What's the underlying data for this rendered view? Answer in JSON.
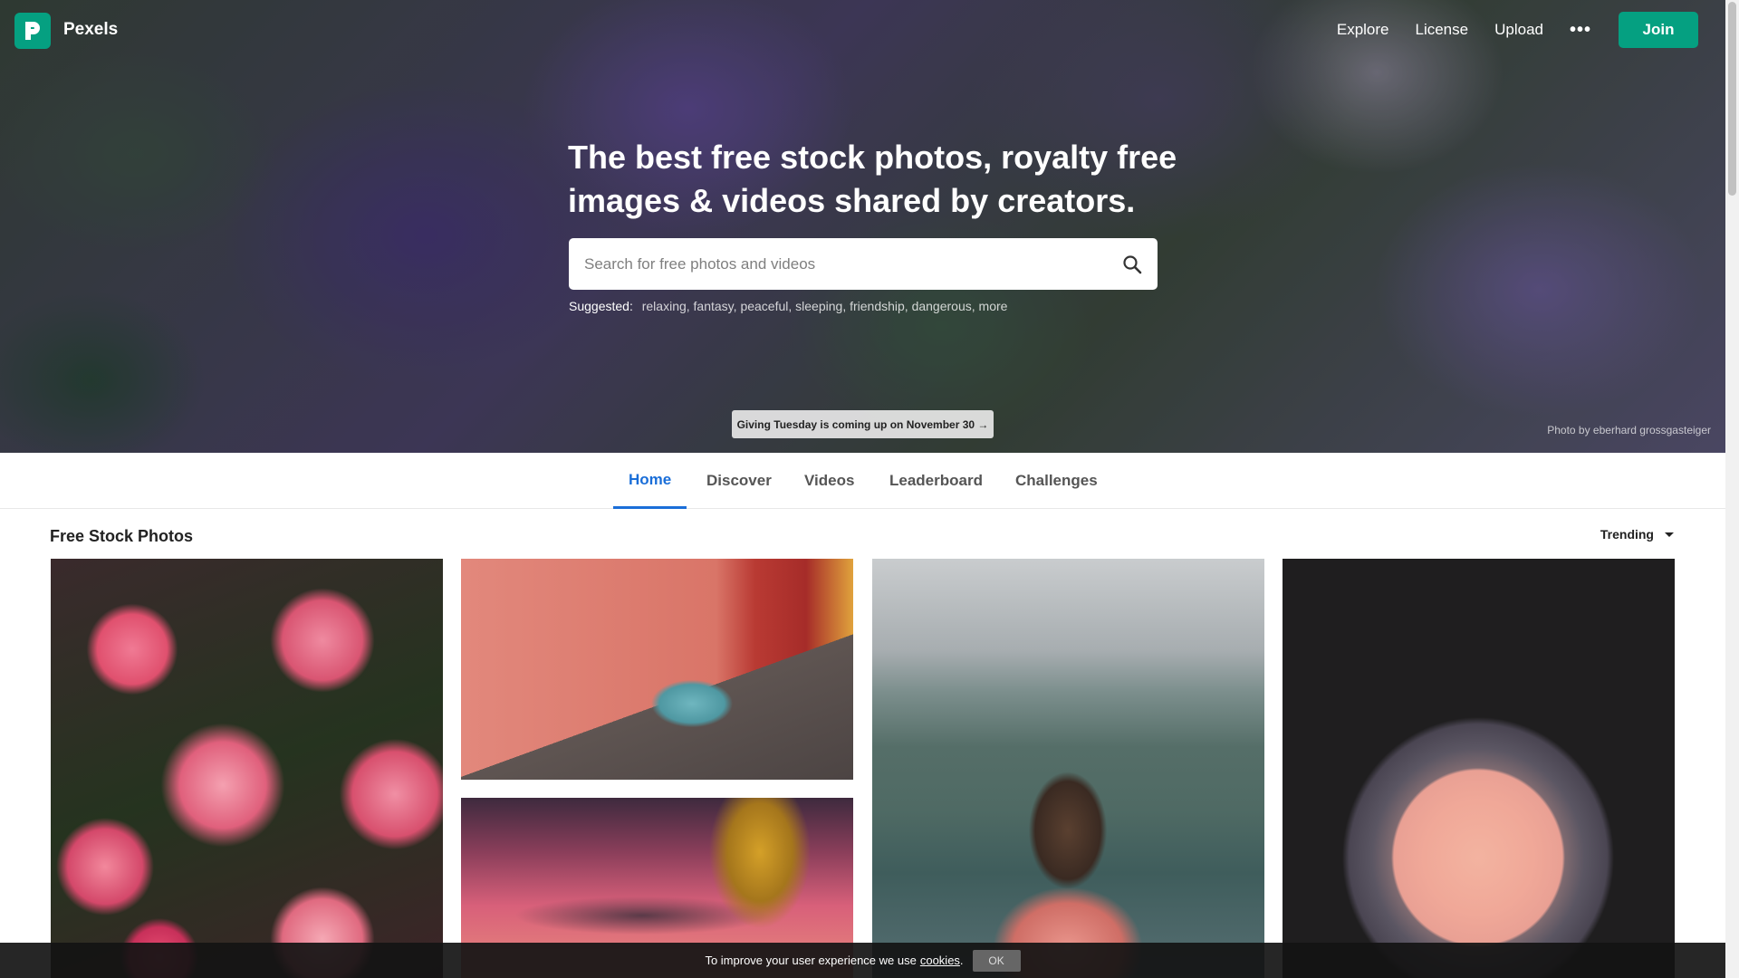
{
  "brand": {
    "name": "Pexels"
  },
  "nav": {
    "links": [
      "Explore",
      "License",
      "Upload"
    ],
    "more_label": "•••",
    "join_label": "Join"
  },
  "hero": {
    "headline": "The best free stock photos, royalty free images & videos shared by creators.",
    "search_placeholder": "Search for free photos and videos",
    "suggested_label": "Suggested:",
    "suggested_tags": [
      "relaxing",
      "fantasy",
      "peaceful",
      "sleeping",
      "friendship",
      "dangerous",
      "more"
    ],
    "giving_banner": "Giving Tuesday is coming up on November 30 →",
    "photo_credit": "Photo by eberhard grossgasteiger"
  },
  "tabs": [
    {
      "label": "Home",
      "active": true
    },
    {
      "label": "Discover",
      "active": false
    },
    {
      "label": "Videos",
      "active": false
    },
    {
      "label": "Leaderboard",
      "active": false
    },
    {
      "label": "Challenges",
      "active": false
    }
  ],
  "section": {
    "title": "Free Stock Photos",
    "sort_value": "Trending"
  },
  "cookie": {
    "text": "To improve your user experience we use",
    "link": "cookies",
    "suffix": ".",
    "ok_label": "OK"
  },
  "colors": {
    "brand": "#05a081",
    "tab_active": "#1a6ed8"
  }
}
